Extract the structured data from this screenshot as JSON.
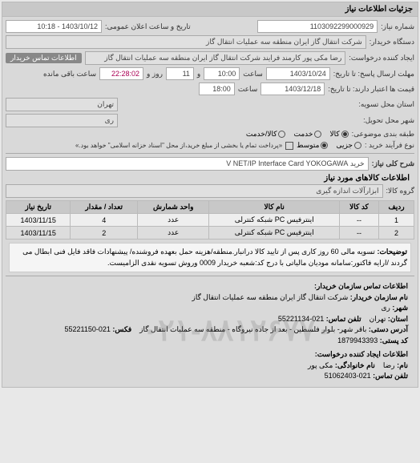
{
  "panel_title": "جزئیات اطلاعات نیاز",
  "fields": {
    "need_no_label": "شماره نیاز:",
    "need_no": "1103092299000929",
    "announce_label": "تاریخ و ساعت اعلان عمومی:",
    "announce": "1403/10/12 - 10:18",
    "buyer_org_label": "دستگاه خریدار:",
    "buyer_org": "شرکت انتقال گاز ایران منطقه سه عملیات انتقال گاز",
    "requester_label": "ایجاد کننده درخواست:",
    "requester": "رضا مکی پور کارمند فرایند شرکت انتقال گاز ایران منطقه سه عملیات انتقال گاز",
    "buyer_contact_chip": "اطلاعات تماس خریدار",
    "reply_deadline_label": "مهلت ارسال پاسخ: تا تاریخ:",
    "reply_date": "1403/10/24",
    "reply_time_label": "ساعت",
    "reply_time": "10:00",
    "days_and": "و",
    "days_remaining": "11",
    "days_remaining_label": "روز و",
    "time_remaining": "22:28:02",
    "time_remaining_label": "ساعت باقی مانده",
    "validity_label": "قیمت ها اعتبار دارند: تا تاریخ:",
    "validity_date": "1403/12/18",
    "validity_time": "18:00",
    "province_label": "استان محل تسویه:",
    "province": "تهران",
    "city_label": "شهر محل تحویل:",
    "city": "ری",
    "class_label": "طبقه بندی موضوعی:",
    "class_options": {
      "goods": "کالا",
      "service": "خدمت",
      "both": "کالا/خدمت"
    },
    "process_label": "نوع فرآیند خرید :",
    "process_options": {
      "small": "جزیی",
      "medium": "متوسط"
    },
    "process_note": "«پرداخت تمام یا بخشی از مبلغ خرید،از محل \"اسناد خزانه اسلامی\" خواهد بود.»",
    "main_title_label": "شرح کلی نیاز:",
    "main_title": "خرید V NET/IP Interface Card YOKOGAWA",
    "items_section": "اطلاعات کالاهای مورد نیاز",
    "group_label": "گروه کالا:",
    "group": "ابزارآلات اندازه گیری"
  },
  "table": {
    "headers": [
      "ردیف",
      "کد کالا",
      "نام کالا",
      "واحد شمارش",
      "تعداد / مقدار",
      "تاریخ نیاز"
    ],
    "rows": [
      [
        "1",
        "--",
        "اینترفیس PC شبکه کنترلی",
        "عدد",
        "4",
        "1403/11/15"
      ],
      [
        "2",
        "--",
        "اینترفیس PC شبکه کنترلی",
        "عدد",
        "2",
        "1403/11/15"
      ]
    ]
  },
  "description": {
    "label": "توضیحات:",
    "text": "تسویه مالی 60 روز کاری پس از تایید کالا درانبار.منطقه/هزینه حمل بعهده فروشنده/ پیشنهادات فاقد فایل فنی ابطال می گردند /ارایه فاکتور:سامانه مودیان مالیاتی با درج کد:شعبه خریدار 0009 وروش تسویه نقدی الزامیست."
  },
  "watermark": "۰۲۱-۸۸۱۲۶۷۷۰",
  "contact_buyer": {
    "title": "اطلاعات تماس سازمان خریدار:",
    "org_label": "نام سازمان خریدار:",
    "org": "شرکت انتقال گاز ایران منطقه سه عملیات انتقال گاز",
    "city_label": "شهر:",
    "city": "ری",
    "province_label": "استان:",
    "province": "تهران",
    "phone_label": "تلفن تماس:",
    "phone": "021-55221134",
    "address_label": "آدرس دستی:",
    "address": "باقر شهر- بلوار فلسطین - بعد از جاده نیروگاه - منطقه سه عملیات انتقال گاز",
    "fax_label": "فکس:",
    "fax": "021-55221150",
    "postal_label": "کد پستی:",
    "postal": "1879943393"
  },
  "contact_requester": {
    "title": "اطلاعات ایجاد کننده درخواست:",
    "name_label": "نام:",
    "name": "رضا",
    "lname_label": "نام خانوادگی:",
    "lname": "مکی پور",
    "phone_label": "تلفن تماس:",
    "phone": "021-51062403"
  }
}
